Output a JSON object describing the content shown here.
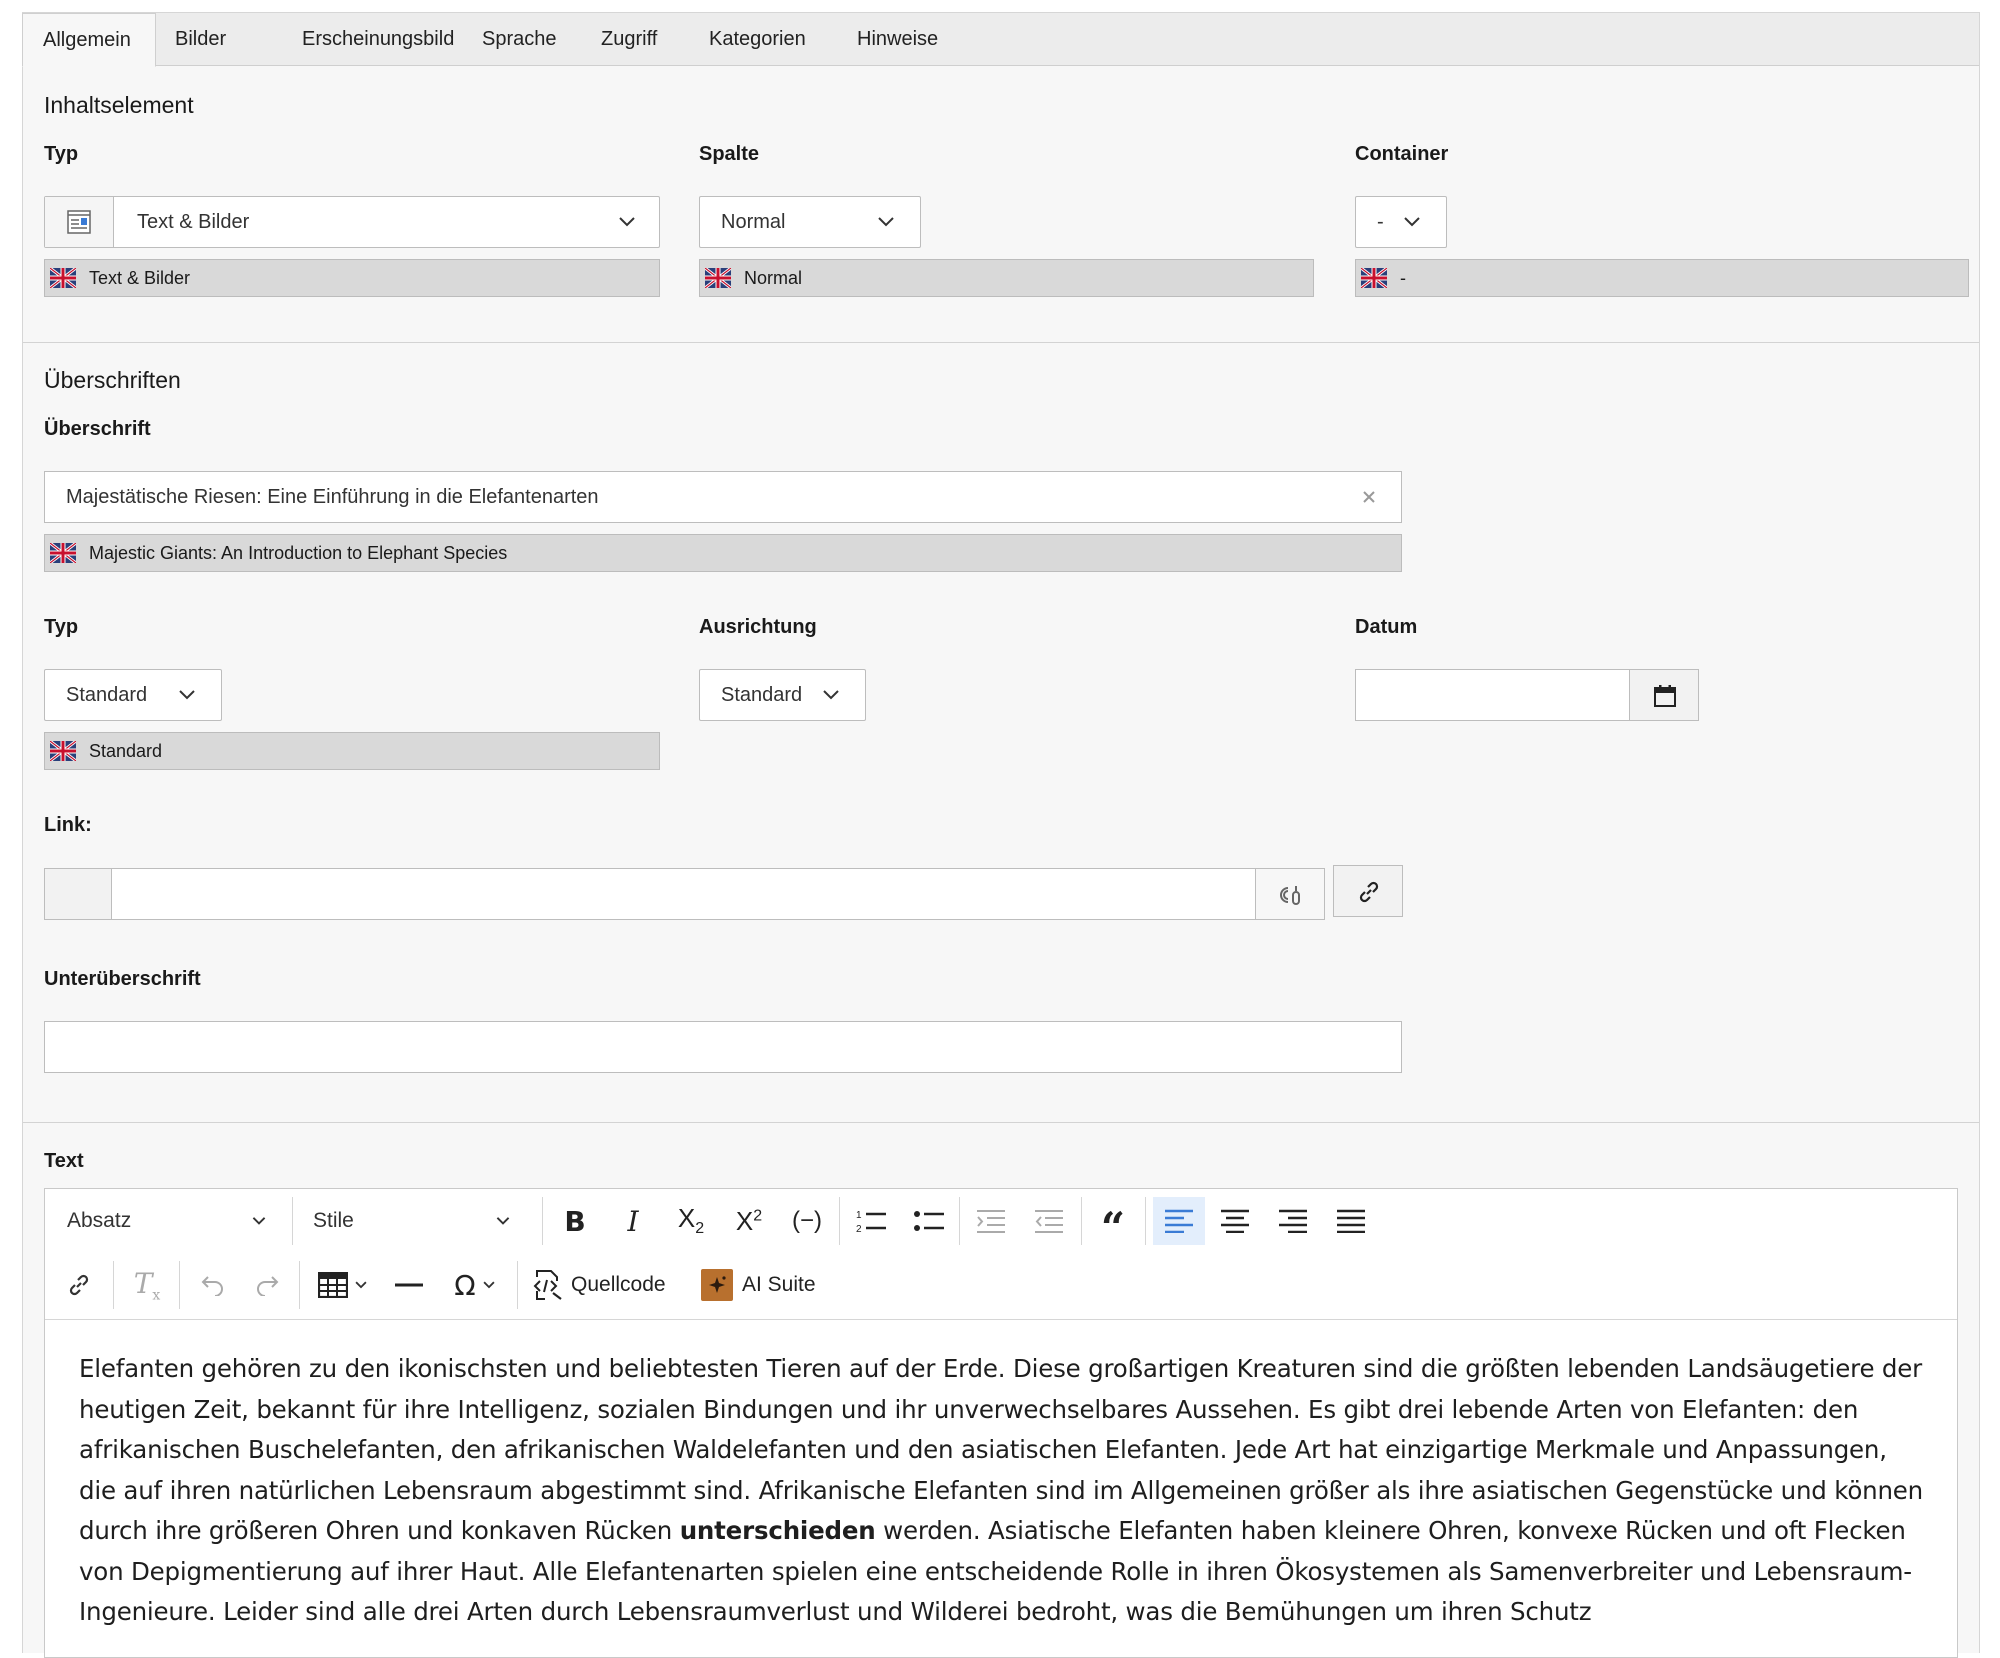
{
  "tabs": [
    "Allgemein",
    "Bilder",
    "Erscheinungsbild",
    "Sprache",
    "Zugriff",
    "Kategorien",
    "Hinweise"
  ],
  "content_element": {
    "section_title": "Inhaltselement",
    "type": {
      "label": "Typ",
      "value": "Text & Bilder",
      "translation": "Text & Bilder"
    },
    "column": {
      "label": "Spalte",
      "value": "Normal",
      "translation": "Normal"
    },
    "container": {
      "label": "Container",
      "value": "-",
      "translation": "-"
    }
  },
  "headings": {
    "section_title": "Überschriften",
    "heading": {
      "label": "Überschrift",
      "value": "Majestätische Riesen: Eine Einführung in die Elefantenarten",
      "translation": "Majestic Giants: An Introduction to Elephant Species"
    },
    "heading_type": {
      "label": "Typ",
      "value": "Standard",
      "translation": "Standard"
    },
    "alignment": {
      "label": "Ausrichtung",
      "value": "Standard"
    },
    "date": {
      "label": "Datum",
      "value": ""
    },
    "link": {
      "label": "Link:",
      "value": ""
    },
    "subheading": {
      "label": "Unterüberschrift",
      "value": ""
    }
  },
  "text": {
    "label": "Text",
    "toolbar": {
      "paragraph": "Absatz",
      "styles": "Stile",
      "source": "Quellcode",
      "ai_suite": "AI Suite"
    },
    "body_before": "Elefanten gehören zu den ikonischsten und beliebtesten Tieren auf der Erde. Diese großartigen Kreaturen sind die größten lebenden Landsäugetiere der heutigen Zeit, bekannt für ihre Intelligenz, sozialen Bindungen und ihr unverwechselbares Aussehen. Es gibt drei lebende Arten von Elefanten: den afrikanischen Buschelefanten, den afrikanischen Waldelefanten und den asiatischen Elefanten. Jede Art hat einzigartige Merkmale und Anpassungen, die auf ihren natürlichen Lebensraum abgestimmt sind. Afrikanische Elefanten sind im Allgemeinen größer als ihre asiatischen Gegenstücke und können durch ihre größeren Ohren und konkaven Rücken ",
    "body_bold": "unterschieden",
    "body_after": " werden. Asiatische Elefanten haben kleinere Ohren, konvexe Rücken und oft Flecken von Depigmentierung auf ihrer Haut. Alle Elefantenarten spielen eine entscheidende Rolle in ihren Ökosystemen als Samenverbreiter und Lebensraum-Ingenieure. Leider sind alle drei Arten durch Lebensraumverlust und Wilderei bedroht, was die Bemühungen um ihren Schutz"
  },
  "colors": {
    "accent": "#3a7bd5",
    "active_button_bg": "#e3eefc",
    "translation_bg": "#d9d9d9",
    "ai_icon": "#b8702e"
  }
}
